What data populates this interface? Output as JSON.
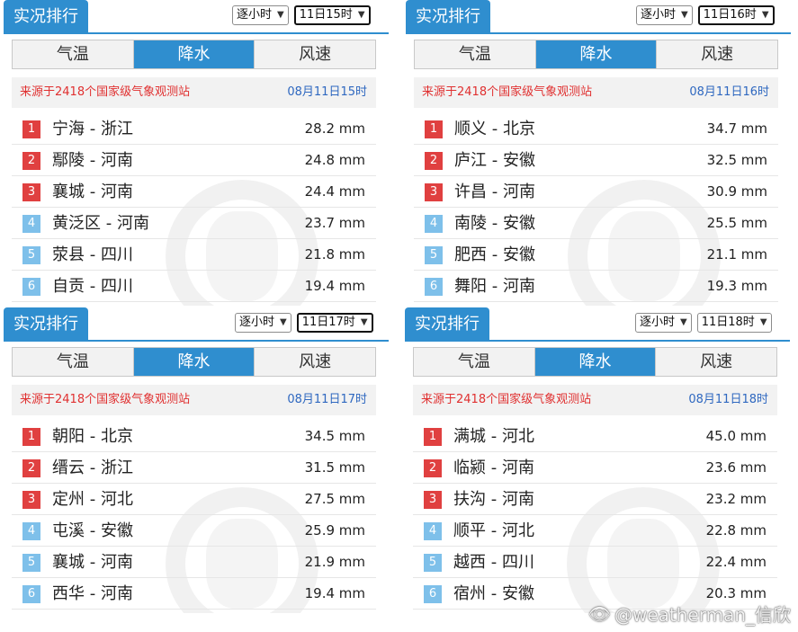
{
  "panels": [
    {
      "header": "实况排行",
      "mode_select": "逐小时",
      "hour_select": "11日15时",
      "tabs": [
        "气温",
        "降水",
        "风速"
      ],
      "active_tab": 1,
      "source": "来源于2418个国家级气象观测站",
      "time": "08月11日15时",
      "rows": [
        {
          "rank": "1",
          "place": "宁海 - 浙江",
          "value": "28.2 mm"
        },
        {
          "rank": "2",
          "place": "鄢陵 - 河南",
          "value": "24.8 mm"
        },
        {
          "rank": "3",
          "place": "襄城 - 河南",
          "value": "24.4 mm"
        },
        {
          "rank": "4",
          "place": "黄泛区 - 河南",
          "value": "23.7 mm"
        },
        {
          "rank": "5",
          "place": "荥县 - 四川",
          "value": "21.8 mm"
        },
        {
          "rank": "6",
          "place": "自贡 - 四川",
          "value": "19.4 mm"
        }
      ]
    },
    {
      "header": "实况排行",
      "mode_select": "逐小时",
      "hour_select": "11日16时",
      "tabs": [
        "气温",
        "降水",
        "风速"
      ],
      "active_tab": 1,
      "source": "来源于2418个国家级气象观测站",
      "time": "08月11日16时",
      "rows": [
        {
          "rank": "1",
          "place": "顺义 - 北京",
          "value": "34.7 mm"
        },
        {
          "rank": "2",
          "place": "庐江 - 安徽",
          "value": "32.5 mm"
        },
        {
          "rank": "3",
          "place": "许昌 - 河南",
          "value": "30.9 mm"
        },
        {
          "rank": "4",
          "place": "南陵 - 安徽",
          "value": "25.5 mm"
        },
        {
          "rank": "5",
          "place": "肥西 - 安徽",
          "value": "21.1 mm"
        },
        {
          "rank": "6",
          "place": "舞阳 - 河南",
          "value": "19.3 mm"
        }
      ]
    },
    {
      "header": "实况排行",
      "mode_select": "逐小时",
      "hour_select": "11日17时",
      "tabs": [
        "气温",
        "降水",
        "风速"
      ],
      "active_tab": 1,
      "source": "来源于2418个国家级气象观测站",
      "time": "08月11日17时",
      "rows": [
        {
          "rank": "1",
          "place": "朝阳 - 北京",
          "value": "34.5 mm"
        },
        {
          "rank": "2",
          "place": "缙云 - 浙江",
          "value": "31.5 mm"
        },
        {
          "rank": "3",
          "place": "定州 - 河北",
          "value": "27.5 mm"
        },
        {
          "rank": "4",
          "place": "屯溪 - 安徽",
          "value": "25.9 mm"
        },
        {
          "rank": "5",
          "place": "襄城 - 河南",
          "value": "21.9 mm"
        },
        {
          "rank": "6",
          "place": "西华 - 河南",
          "value": "19.4 mm"
        }
      ]
    },
    {
      "header": "实况排行",
      "mode_select": "逐小时",
      "hour_select": "11日18时",
      "tabs": [
        "气温",
        "降水",
        "风速"
      ],
      "active_tab": 1,
      "source": "来源于2418个国家级气象观测站",
      "time": "08月11日18时",
      "rows": [
        {
          "rank": "1",
          "place": "满城 - 河北",
          "value": "45.0 mm"
        },
        {
          "rank": "2",
          "place": "临颍 - 河南",
          "value": "23.6 mm"
        },
        {
          "rank": "3",
          "place": "扶沟 - 河南",
          "value": "23.2 mm"
        },
        {
          "rank": "4",
          "place": "顺平 - 河北",
          "value": "22.8 mm"
        },
        {
          "rank": "5",
          "place": "越西 - 四川",
          "value": "22.4 mm"
        },
        {
          "rank": "6",
          "place": "宿州 - 安徽",
          "value": "20.3 mm"
        }
      ]
    }
  ],
  "watermark": "@weatherman_信欣",
  "colors": {
    "accent": "#2f8ecf",
    "rank_top": "#e04040",
    "rank_rest": "#7ec0ea",
    "source_red": "#e03030",
    "time_blue": "#2f68c0"
  }
}
